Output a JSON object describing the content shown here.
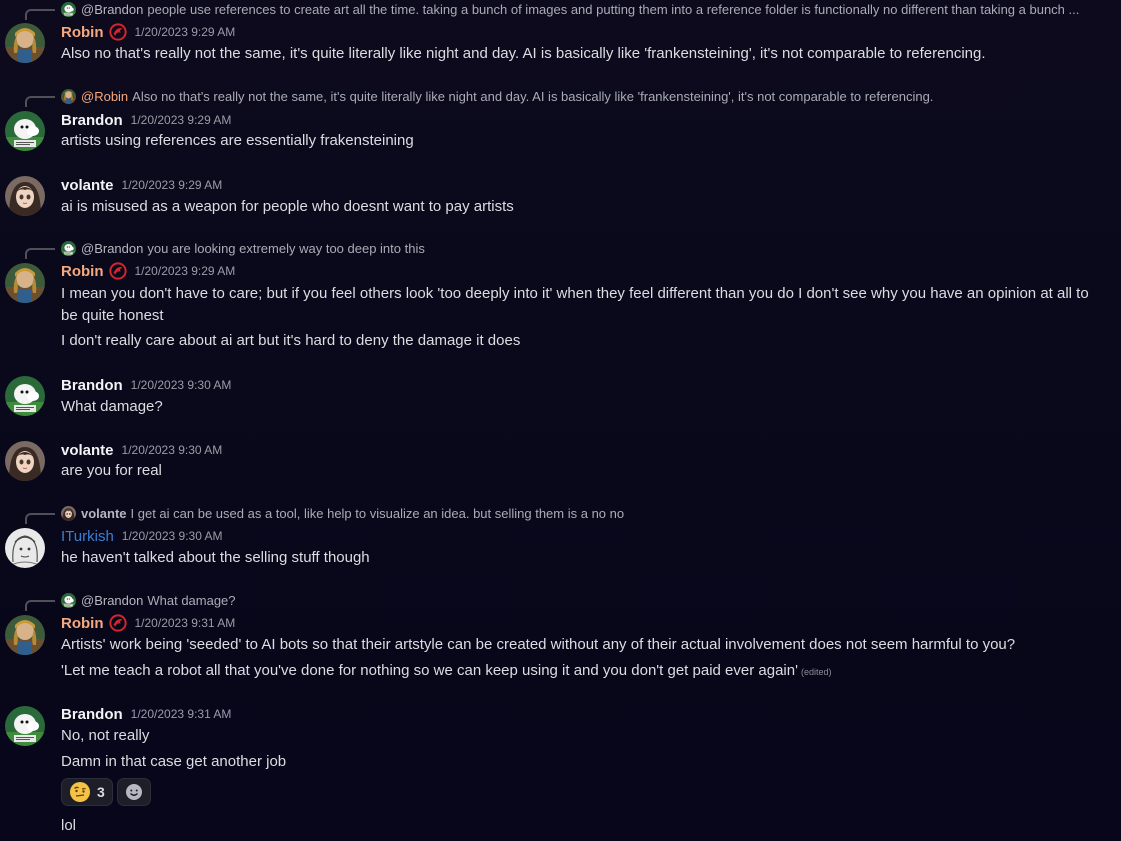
{
  "messages": [
    {
      "reply": {
        "user": "@Brandon",
        "text": "people use references to create art all the time. taking a bunch of images and putting them into a reference folder is functionally no different than taking a bunch ..."
      },
      "author": "Robin",
      "timestamp": "1/20/2023 9:29 AM",
      "lines": [
        "Also no that's really not the same, it's quite literally like night and day. AI is basically like 'frankensteining', it's not comparable to referencing."
      ]
    },
    {
      "reply": {
        "user": "@Robin",
        "text": "Also no that's really not the same, it's quite literally like night and day. AI is basically like 'frankensteining', it's not comparable to referencing."
      },
      "author": "Brandon",
      "timestamp": "1/20/2023 9:29 AM",
      "lines": [
        "artists using references are essentially frakensteining"
      ]
    },
    {
      "author": "volante",
      "timestamp": "1/20/2023 9:29 AM",
      "lines": [
        "ai is misused as a weapon for people who doesnt want to pay artists"
      ]
    },
    {
      "reply": {
        "user": "@Brandon",
        "text": "you are looking extremely way too deep into this"
      },
      "author": "Robin",
      "timestamp": "1/20/2023 9:29 AM",
      "lines": [
        "I mean you don't have to care; but if you feel others look 'too deeply into it' when they feel different than you do I don't see why you have an opinion at all to",
        "be quite honest",
        "I don't really care about ai art but it's hard to deny the damage it does"
      ]
    },
    {
      "author": "Brandon",
      "timestamp": "1/20/2023 9:30 AM",
      "lines": [
        "What damage?"
      ]
    },
    {
      "author": "volante",
      "timestamp": "1/20/2023 9:30 AM",
      "lines": [
        "are you for real"
      ]
    },
    {
      "reply": {
        "user": "volante",
        "text": "I get ai can be used as a tool, like help to visualize an idea. but selling them is a no no"
      },
      "author": "ITurkish",
      "timestamp": "1/20/2023 9:30 AM",
      "lines": [
        "he haven't talked about the selling stuff though"
      ]
    },
    {
      "reply": {
        "user": "@Brandon",
        "text": "What damage?"
      },
      "author": "Robin",
      "timestamp": "1/20/2023 9:31 AM",
      "lines": [
        "Artists' work being 'seeded' to AI bots so that their artstyle can be created without any of their actual involvement does not seem harmful to you?",
        "'Let me teach a robot all that you've done for nothing so we can keep using it and you don't get paid ever again'"
      ],
      "edited": "(edited)"
    },
    {
      "author": "Brandon",
      "timestamp": "1/20/2023 9:31 AM",
      "lines": [
        "No, not really",
        "Damn in that case get another job",
        "lol"
      ],
      "reactions": [
        {
          "icon": "raised-eyebrow-emoji",
          "count": "3"
        },
        {
          "icon": "add-reaction-icon",
          "count": ""
        }
      ]
    }
  ],
  "colors": {
    "robin": "#f5a97f",
    "brandon": "#f2f3f5",
    "volante": "#f2f3f5",
    "iturkish": "#3a7fcf",
    "background": "#0c0a1c"
  }
}
